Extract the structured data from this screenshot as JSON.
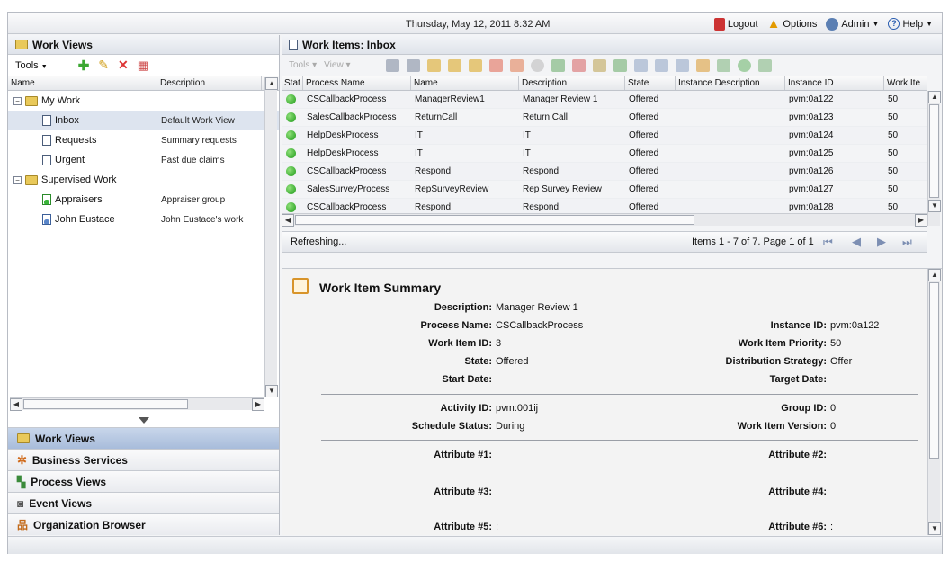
{
  "topbar": {
    "date": "Thursday, May 12, 2011 8:32 AM",
    "logout": "Logout",
    "options": "Options",
    "admin": "Admin",
    "help": "Help"
  },
  "left": {
    "title": "Work Views",
    "tools_label": "Tools",
    "columns": [
      "Name",
      "Description"
    ],
    "tree": [
      {
        "label": "My Work",
        "desc": "",
        "level": 0,
        "type": "folder"
      },
      {
        "label": "Inbox",
        "desc": "Default Work View",
        "level": 1,
        "type": "doc"
      },
      {
        "label": "Requests",
        "desc": "Summary requests",
        "level": 1,
        "type": "doc"
      },
      {
        "label": "Urgent",
        "desc": "Past due claims",
        "level": 1,
        "type": "doc"
      },
      {
        "label": "Supervised Work",
        "desc": "",
        "level": 0,
        "type": "folder"
      },
      {
        "label": "Appraisers",
        "desc": "Appraiser group",
        "level": 1,
        "type": "group"
      },
      {
        "label": "John Eustace",
        "desc": "John Eustace's work",
        "level": 1,
        "type": "user"
      }
    ],
    "nav": [
      "Work Views",
      "Business Services",
      "Process Views",
      "Event Views",
      "Organization Browser"
    ]
  },
  "grid": {
    "title": "Work Items: Inbox",
    "toolbar": {
      "tools": "Tools",
      "view": "View"
    },
    "columns": [
      "Stat",
      "Process Name",
      "Name",
      "Description",
      "State",
      "Instance Description",
      "Instance ID",
      "Work Ite"
    ],
    "rows": [
      [
        "CSCallbackProcess",
        "ManagerReview1",
        "Manager Review 1",
        "Offered",
        "",
        "pvm:0a122",
        "50"
      ],
      [
        "SalesCallbackProcess",
        "ReturnCall",
        "Return Call",
        "Offered",
        "",
        "pvm:0a123",
        "50"
      ],
      [
        "HelpDeskProcess",
        "IT",
        "IT",
        "Offered",
        "",
        "pvm:0a124",
        "50"
      ],
      [
        "HelpDeskProcess",
        "IT",
        "IT",
        "Offered",
        "",
        "pvm:0a125",
        "50"
      ],
      [
        "CSCallbackProcess",
        "Respond",
        "Respond",
        "Offered",
        "",
        "pvm:0a126",
        "50"
      ],
      [
        "SalesSurveyProcess",
        "RepSurveyReview",
        "Rep Survey Review",
        "Offered",
        "",
        "pvm:0a127",
        "50"
      ],
      [
        "CSCallbackProcess",
        "Respond",
        "Respond",
        "Offered",
        "",
        "pvm:0a128",
        "50"
      ]
    ],
    "status": "Refreshing...",
    "paging": "Items 1 - 7 of 7. Page 1 of 1"
  },
  "summary": {
    "title": "Work Item Summary",
    "fields": {
      "description_l": "Description:",
      "description_v": "Manager Review 1",
      "process_l": "Process Name:",
      "process_v": "CSCallbackProcess",
      "instance_l": "Instance ID:",
      "instance_v": "pvm:0a122",
      "workitem_l": "Work Item ID:",
      "workitem_v": "3",
      "priority_l": "Work Item Priority:",
      "priority_v": "50",
      "state_l": "State:",
      "state_v": "Offered",
      "dist_l": "Distribution Strategy:",
      "dist_v": "Offer",
      "start_l": "Start Date:",
      "target_l": "Target Date:",
      "activity_l": "Activity ID:",
      "activity_v": "pvm:001ij",
      "group_l": "Group ID:",
      "group_v": "0",
      "schedule_l": "Schedule Status:",
      "schedule_v": "During",
      "version_l": "Work Item Version:",
      "version_v": "0",
      "a1": "Attribute #1:",
      "a2": "Attribute #2:",
      "a3": "Attribute #3:",
      "a4": "Attribute #4:",
      "a5": "Attribute #5:",
      "a5v": ":",
      "a6": "Attribute #6:",
      "a6v": ":"
    }
  }
}
